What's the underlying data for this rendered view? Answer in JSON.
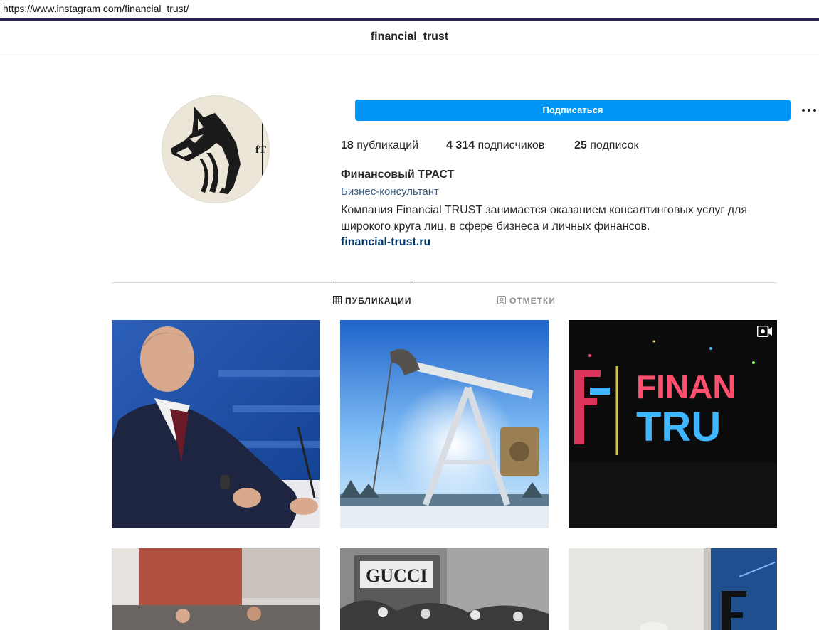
{
  "browser": {
    "url": "https://www.instagram com/financial_trust/"
  },
  "header": {
    "username": "financial_trust"
  },
  "profile": {
    "follow_label": "Подписаться",
    "more_icon": "more-options-icon",
    "stats": {
      "posts_count": "18",
      "posts_label": "публикаций",
      "followers_count": "4 314",
      "followers_label": "подписчиков",
      "following_count": "25",
      "following_label": "подписок"
    },
    "full_name": "Финансовый ТРАСТ",
    "category": "Бизнес-консультант",
    "bio_lines": [
      "Компания Financial TRUST занимается оказанием консалтинговых услуг для",
      "широкого круга лиц, в сфере бизнеса и личных финансов."
    ],
    "website": "financial-trust.ru"
  },
  "tabs": [
    {
      "label": "ПУБЛИКАЦИИ",
      "icon": "grid-icon",
      "active": true
    },
    {
      "label": "ОТМЕТКИ",
      "icon": "tagged-icon",
      "active": false
    }
  ],
  "posts": [
    {
      "subject": "man in suit at conference"
    },
    {
      "subject": "oil pumpjack against sky"
    },
    {
      "subject": "FINANCIAL TRUST neon logo",
      "badge_icon": "video-icon",
      "overlay": [
        "FINAN",
        "TRU"
      ]
    },
    {
      "subject": "brick building street"
    },
    {
      "subject": "GUCCI storefront crowd",
      "overlay": [
        "GUCCI"
      ]
    },
    {
      "subject": "financial trust branded card"
    }
  ],
  "colors": {
    "accent": "#0095f6",
    "link": "#00376b",
    "category": "#3c5a80"
  }
}
